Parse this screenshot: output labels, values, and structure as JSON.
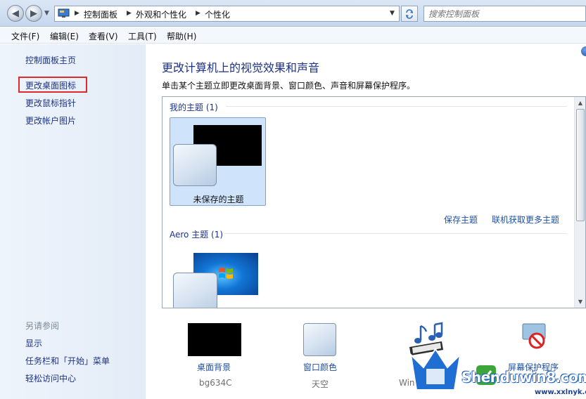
{
  "address": {
    "crumbs": [
      "控制面板",
      "外观和个性化",
      "个性化"
    ],
    "search_placeholder": "搜索控制面板"
  },
  "menu": [
    "文件(F)",
    "编辑(E)",
    "查看(V)",
    "工具(T)",
    "帮助(H)"
  ],
  "sidebar": {
    "home": "控制面板主页",
    "links": [
      "更改桌面图标",
      "更改鼠标指针",
      "更改帐户图片"
    ],
    "see_also_title": "另请参阅",
    "see_also": [
      "显示",
      "任务栏和「开始」菜单",
      "轻松访问中心"
    ]
  },
  "main": {
    "title": "更改计算机上的视觉效果和声音",
    "description": "单击某个主题立即更改桌面背景、窗口颜色、声音和屏幕保护程序。",
    "my_themes_heading": "我的主题 (1)",
    "unsaved_theme_label": "未保存的主题",
    "save_theme_link": "保存主题",
    "online_themes_link": "联机获取更多主题",
    "aero_heading": "Aero 主题 (1)"
  },
  "options": {
    "background_label": "桌面背景",
    "background_value": "bg634C",
    "color_label": "窗口颜色",
    "color_value": "天空",
    "sound_value": "Wind",
    "saver_label": "屏幕保护程序"
  },
  "watermark": {
    "logo_text": "Shenduwin8.com",
    "url": "www.xxlnyk.com"
  },
  "colors": {
    "link": "#1e3287",
    "highlight": "#e02a2a",
    "selected_theme_bg": "#cfe4fb"
  }
}
